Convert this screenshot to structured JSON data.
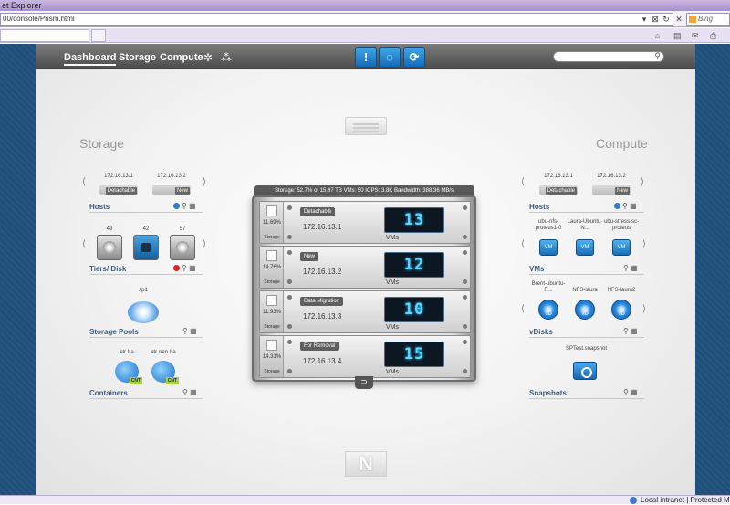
{
  "browser": {
    "title": "et Explorer",
    "url": "00/console/Prism.html",
    "search_placeholder": "Bing",
    "status_text": "Local intranet | Protected Mode: Of"
  },
  "nav": {
    "tabs": [
      "Dashboard",
      "Storage",
      "Compute"
    ],
    "active_tab": "Dashboard"
  },
  "left_panel": {
    "title": "Storage",
    "hosts": {
      "label": "Hosts",
      "items": [
        {
          "ip": "172.16.13.1",
          "badge": "Detachable"
        },
        {
          "ip": "172.16.13.2",
          "badge": "New"
        }
      ]
    },
    "tiers": {
      "label_prefix": "Tiers",
      "label_suffix": "/ Disk",
      "counts": [
        "43",
        "42",
        "57"
      ]
    },
    "storage_pools": {
      "label": "Storage Pools",
      "pool_name": "sp1"
    },
    "containers": {
      "label": "Containers",
      "items": [
        {
          "name": "ctr-ha",
          "badge": "CNT"
        },
        {
          "name": "ctr-non-ha",
          "badge": "CNT"
        }
      ]
    }
  },
  "cluster": {
    "header": "Storage: 52.7% of 15.97 TB   VMs: 50   IOPS: 3.8K   Bandwidth: 388.36 MB/s",
    "storage_label": "Storage",
    "vms_label": "VMs",
    "nodes": [
      {
        "pct": "11.69%",
        "tag": "Detachable",
        "ip": "172.16.13.1",
        "vms": "13"
      },
      {
        "pct": "14.76%",
        "tag": "New",
        "ip": "172.16.13.2",
        "vms": "12"
      },
      {
        "pct": "11.93%",
        "tag": "Data Migration",
        "ip": "172.16.13.3",
        "vms": "10"
      },
      {
        "pct": "14.31%",
        "tag": "For Removal",
        "ip": "172.16.13.4",
        "vms": "15"
      }
    ]
  },
  "right_panel": {
    "title": "Compute",
    "hosts": {
      "label": "Hosts",
      "items": [
        {
          "ip": "172.16.13.1",
          "badge": "Detachable"
        },
        {
          "ip": "172.16.13.2",
          "badge": "New"
        }
      ]
    },
    "vms": {
      "label": "VMs",
      "items": [
        "ubu-nfs-proteus1-0",
        "Laura-Ubuntu-N...",
        "ubu-stress-sc-proteus"
      ],
      "icon_text": "VM"
    },
    "vdisks": {
      "label": "vDisks",
      "items": [
        "Brent-ubuntu-R...",
        "NFS-laura",
        "NFS-laura2"
      ],
      "icon_text": "vD"
    },
    "snapshots": {
      "label": "Snapshots",
      "items": [
        "SPTest.snapshot"
      ]
    }
  },
  "colors": {
    "accent": "#1669b6",
    "led": "#58d8ff",
    "navbar": "#5a5a5a"
  }
}
